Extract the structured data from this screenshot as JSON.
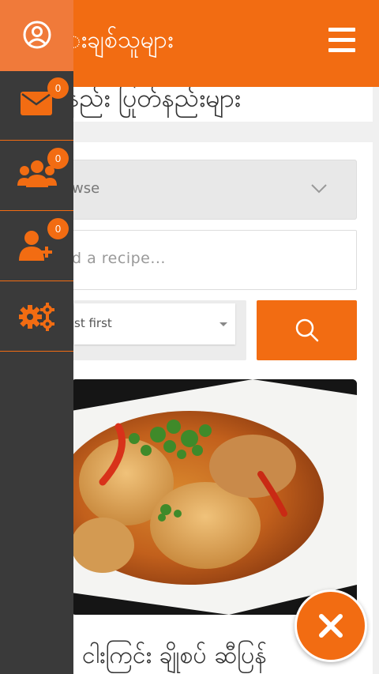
{
  "header": {
    "title": "းချစ်သူများ",
    "accent_color": "#f26c12"
  },
  "subtitle": "နည်း ပြုတ်နည်းများ",
  "filters": {
    "browse_label": "wse",
    "search_placeholder": "d a recipe...",
    "sort_label": "st first"
  },
  "recipe": {
    "title": "ငါးကြင်း ချိုစပ် ဆီပြန်"
  },
  "drawer": {
    "items": [
      {
        "name": "messages",
        "icon": "envelope-icon",
        "badge": "0"
      },
      {
        "name": "groups",
        "icon": "users-group-icon",
        "badge": "0"
      },
      {
        "name": "add-friend",
        "icon": "user-plus-icon",
        "badge": "0"
      },
      {
        "name": "settings",
        "icon": "gears-icon"
      }
    ]
  },
  "icons": {
    "profile": "user-circle-icon",
    "menu": "hamburger-icon",
    "search": "search-icon",
    "close": "close-icon",
    "dropdown": "chevron-down-icon"
  }
}
